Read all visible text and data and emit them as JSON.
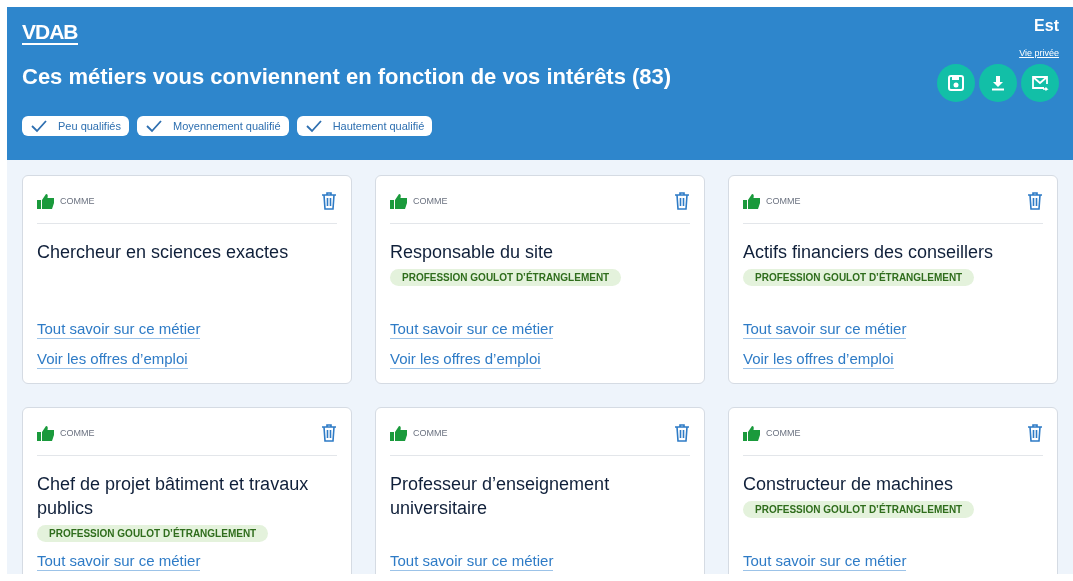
{
  "header": {
    "logo": "VDAB",
    "language": "Est",
    "privacy_link": "Vie privée",
    "title": "Ces métiers vous conviennent en fonction de vos intérêts (83)",
    "filters": [
      {
        "label": "Peu qualifiés",
        "checked": true
      },
      {
        "label": "Moyennement qualifié",
        "checked": true
      },
      {
        "label": "Hautement qualifié",
        "checked": true
      }
    ]
  },
  "cards": [
    {
      "like_label": "COMME",
      "title": "Chercheur en sciences exactes",
      "links": [
        "Tout savoir sur ce métier",
        "Voir les offres d’emploi"
      ]
    },
    {
      "like_label": "COMME",
      "title": "Responsable du site",
      "badge": "PROFESSION GOULOT D’ÉTRANGLEMENT",
      "links": [
        "Tout savoir sur ce métier",
        "Voir les offres d’emploi"
      ]
    },
    {
      "like_label": "COMME",
      "title": "Actifs financiers des conseillers",
      "badge": "PROFESSION GOULOT D’ÉTRANGLEMENT",
      "links": [
        "Tout savoir sur ce métier",
        "Voir les offres d’emploi"
      ]
    },
    {
      "like_label": "COMME",
      "title": "Chef de projet bâtiment et travaux publics",
      "badge": "PROFESSION GOULOT D’ÉTRANGLEMENT",
      "links": [
        "Tout savoir sur ce métier"
      ]
    },
    {
      "like_label": "COMME",
      "title": "Professeur d’enseignement universitaire",
      "links": [
        "Tout savoir sur ce métier"
      ]
    },
    {
      "like_label": "COMME",
      "title": "Constructeur de machines",
      "badge": "PROFESSION GOULOT D’ÉTRANGLEMENT",
      "links": [
        "Tout savoir sur ce métier"
      ]
    }
  ]
}
